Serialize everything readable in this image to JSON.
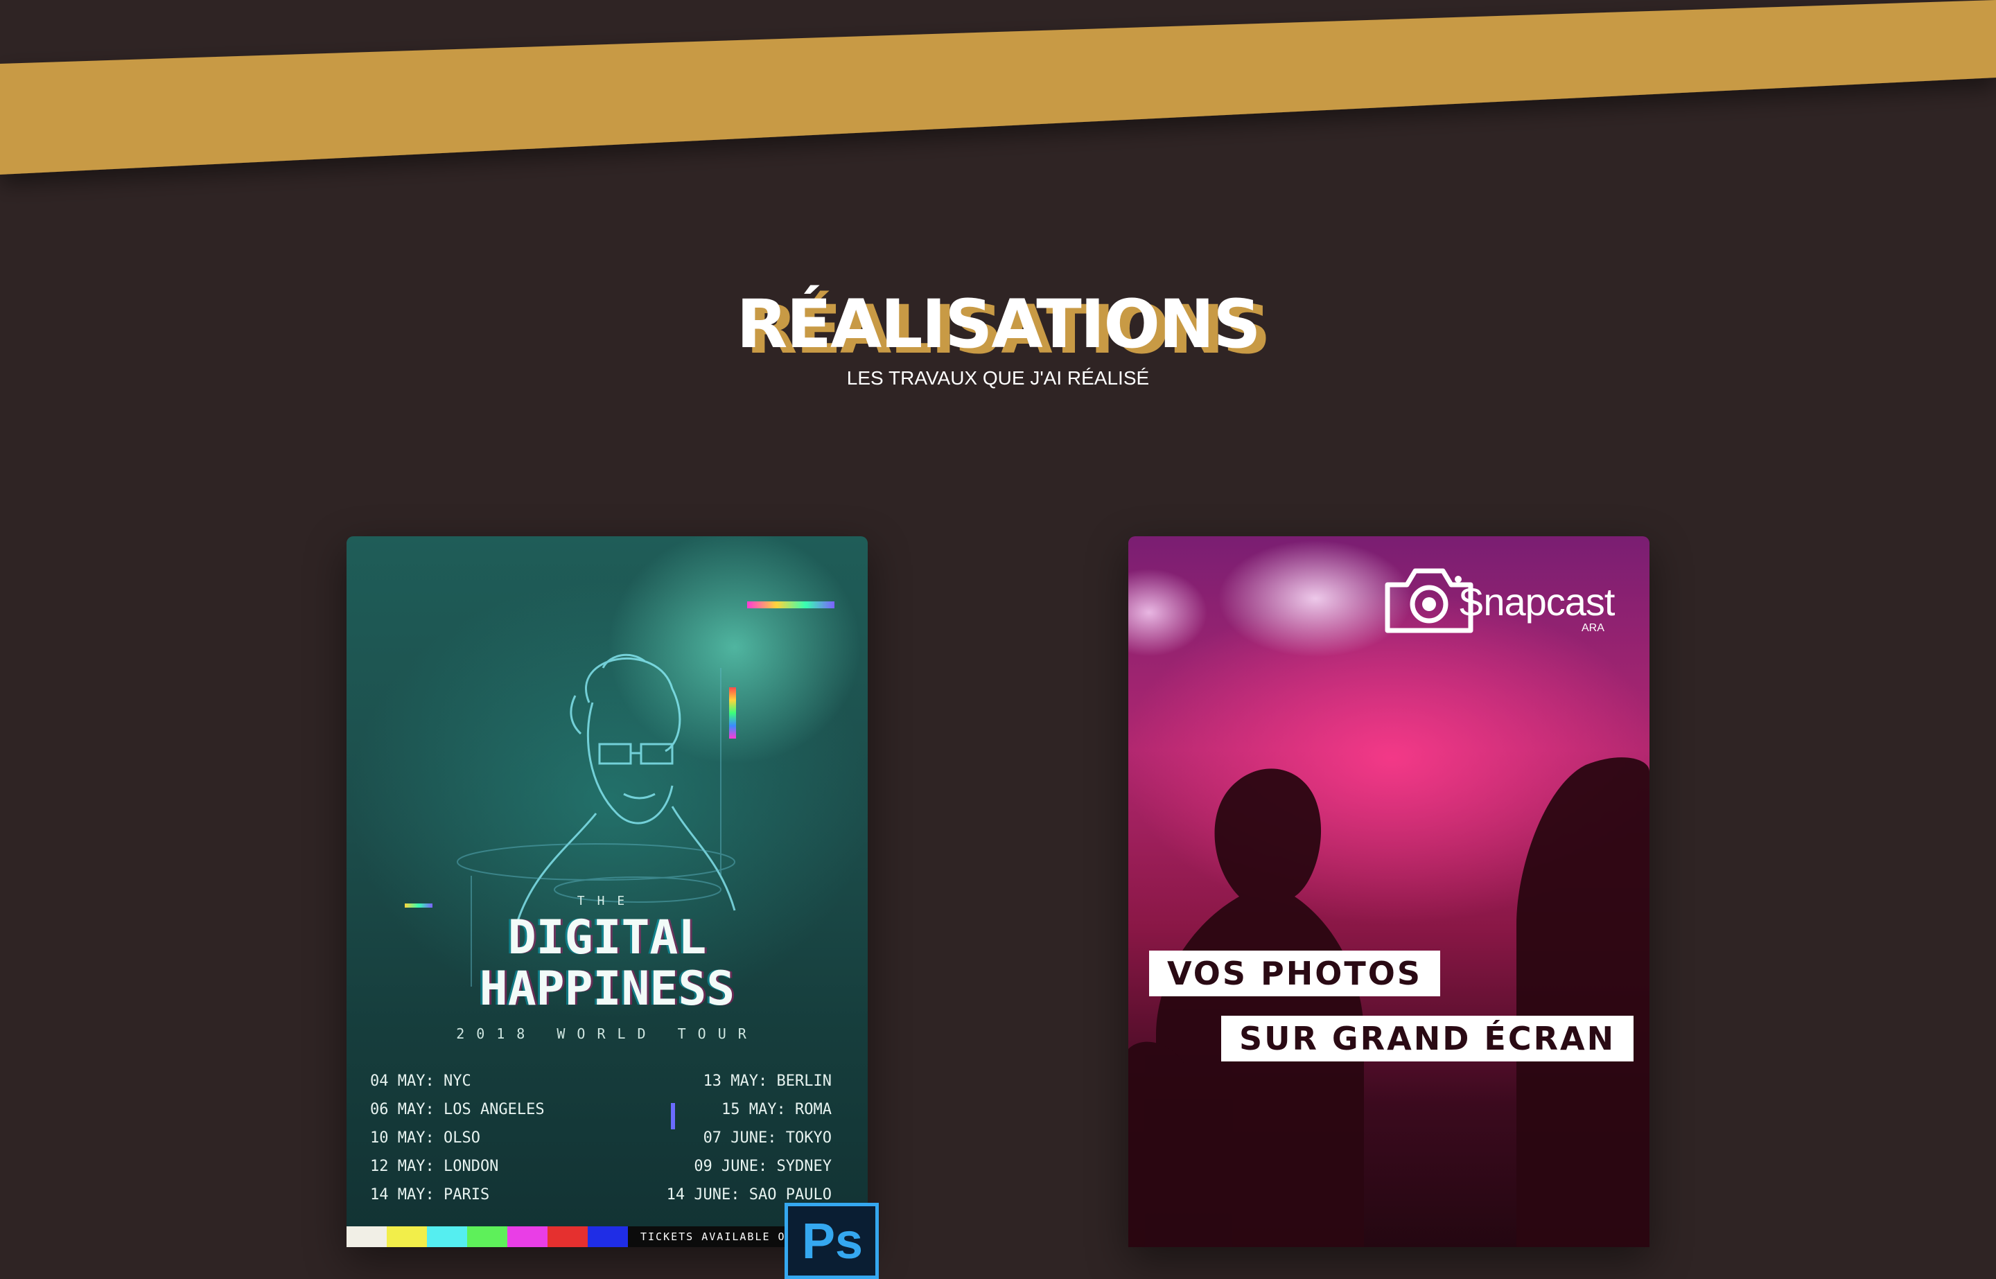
{
  "colors": {
    "background": "#2f2424",
    "accent_gold": "#c89a45"
  },
  "section": {
    "title": "RÉALISATIONS",
    "subtitle": "LES TRAVAUX QUE J'AI RÉALISÉ"
  },
  "projects": [
    {
      "poster": {
        "the": "THE",
        "line1": "DIGITAL",
        "line2": "HAPPINESS",
        "tour": "2018 WORLD TOUR",
        "dates_left": [
          "04 MAY: NYC",
          "06 MAY: LOS ANGELES",
          "10 MAY: OLSO",
          "12 MAY: LONDON",
          "14 MAY: PARIS"
        ],
        "dates_right": [
          "13 MAY: BERLIN",
          "15 MAY: ROMA",
          "07 JUNE: TOKYO",
          "09 JUNE: SYDNEY",
          "14 JUNE: SAO PAULO"
        ],
        "tickets": "TICKETS AVAILABLE ON"
      },
      "tool_badge": "Ps",
      "icon": "photoshop-icon"
    },
    {
      "brand": "Snapcast",
      "brand_sub": "ARA",
      "icon": "camera-icon",
      "tag_1": "VOS PHOTOS",
      "tag_2": "SUR GRAND ÉCRAN"
    }
  ]
}
